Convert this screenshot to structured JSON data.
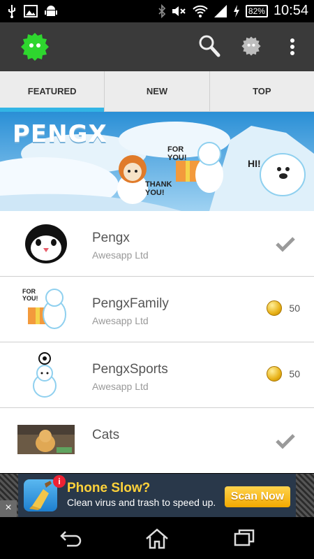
{
  "status_bar": {
    "icons": [
      "usb-icon",
      "image-icon",
      "android-icon",
      "bluetooth-icon",
      "mute-icon",
      "wifi-icon",
      "signal-icon",
      "charging-icon"
    ],
    "battery": "82%",
    "time": "10:54"
  },
  "action_bar": {
    "icons": [
      "app-logo-icon",
      "search-icon",
      "avatar-icon",
      "overflow-menu-icon"
    ]
  },
  "tabs": [
    {
      "label": "FEATURED",
      "active": true
    },
    {
      "label": "NEW",
      "active": false
    },
    {
      "label": "TOP",
      "active": false
    }
  ],
  "banner": {
    "title": "PENGX",
    "bubble_1": "FOR YOU!",
    "bubble_2": "THANK YOU!",
    "bubble_3": "HI!"
  },
  "list": [
    {
      "title": "Pengx",
      "subtitle": "Awesapp Ltd",
      "status": "owned",
      "price": ""
    },
    {
      "title": "PengxFamily",
      "subtitle": "Awesapp Ltd",
      "status": "price",
      "price": "50"
    },
    {
      "title": "PengxSports",
      "subtitle": "Awesapp Ltd",
      "status": "price",
      "price": "50"
    },
    {
      "title": "Cats",
      "subtitle": "",
      "status": "owned",
      "price": ""
    }
  ],
  "thumb_text": {
    "family_bubble": "FOR YOU!"
  },
  "ad": {
    "title": "Phone Slow?",
    "text": "Clean virus and trash to speed up.",
    "button": "Scan Now",
    "badge": "i",
    "close": "×"
  },
  "colors": {
    "accent": "#33b5e5",
    "action_bar": "#3a3a3a",
    "logo_green": "#2ed62e"
  }
}
